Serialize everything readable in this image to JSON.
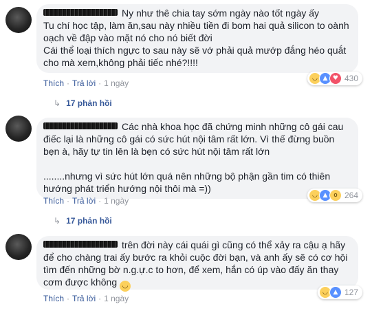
{
  "comments": [
    {
      "text": "Ny như thê chia tay sớm ngày nào tốt ngày ấy\nTu chí học tập, làm ăn,sau này nhiều tiền đi bom hai quả silicon to oành oạch về đập vào mặt nó cho nó biết đời\nCái thể loại thích ngực to sau này sẽ vớ phải quả mướp đắng héo quắt cho mà xem,không phải tiếc nhé?!!!!",
      "like_label": "Thích",
      "reply_label": "Trả lời",
      "time": "1 ngày",
      "reaction_icons": [
        "haha",
        "like",
        "love"
      ],
      "reaction_count": "430",
      "replies_label": "17 phản hồi"
    },
    {
      "text": "Các nhà khoa học đã chứng minh những cô gái cau điếc lại là những cô gái có sức hút nội tâm rất lớn. Vì thế đừng buồn bẹn à, hãy tự tin lên là bẹn có sức hút nội tâm rất lớn\n\n........nhưng vì sức hút lớn quá nên những bộ phận gần tim có thiên hướng phát triển hướng nội thôi mà =))",
      "like_label": "Thích",
      "reply_label": "Trả lời",
      "time": "1 ngày",
      "reaction_icons": [
        "haha",
        "like",
        "wow"
      ],
      "reaction_count": "264",
      "replies_label": "17 phản hồi"
    },
    {
      "text": "trên đời này cái quái gì cũng có thể xảy ra cậu ạ hãy để cho chàng trai ấy bước ra khỏi cuộc đời bạn, và anh ấy sẽ có cơ hội tìm đến những bờ n.g.ự.c to hơn, để xem, hắn có úp vào đấy ăn thay cơm được không",
      "like_label": "Thích",
      "reply_label": "Trả lời",
      "time": "1 ngày",
      "reaction_icons": [
        "haha",
        "like"
      ],
      "reaction_count": "127"
    }
  ]
}
